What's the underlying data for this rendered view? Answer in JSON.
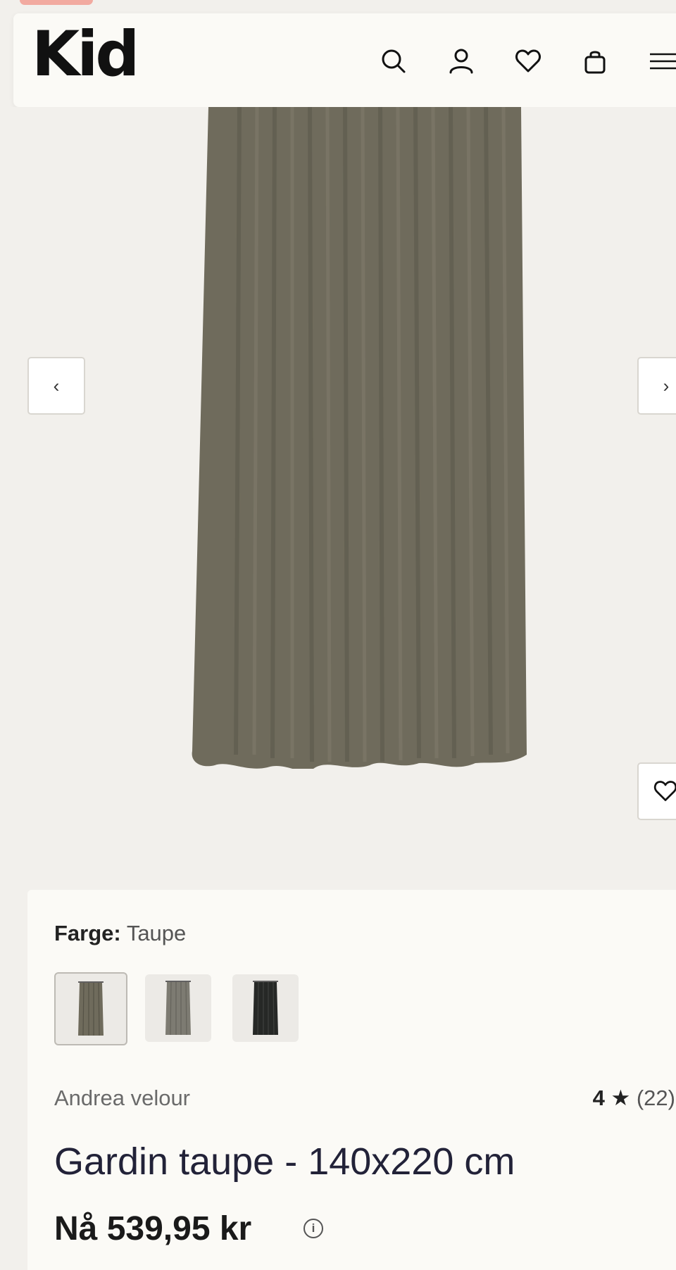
{
  "header": {
    "logo": "Kid",
    "icons": [
      "search-icon",
      "account-icon",
      "wishlist-icon",
      "cart-icon",
      "menu-icon"
    ]
  },
  "gallery": {
    "prev_label": "‹",
    "next_label": "›"
  },
  "product": {
    "color_label": "Farge:",
    "color_value": "Taupe",
    "swatches": [
      {
        "name": "Taupe",
        "color": "#6f6b5c",
        "selected": true
      },
      {
        "name": "Grey",
        "color": "#7d7b72",
        "selected": false
      },
      {
        "name": "Black",
        "color": "#262826",
        "selected": false
      }
    ],
    "brand": "Andrea velour",
    "rating": "4",
    "rating_star": "★",
    "rating_count": "(22)",
    "title": "Gardin taupe - 140x220 cm",
    "price": "Nå 539,95 kr",
    "info_glyph": "i"
  },
  "colors": {
    "background": "#f2f0ec",
    "panel": "#fbfaf6",
    "curtain": "#6f6b5c",
    "promo": "#f2aaa0"
  }
}
